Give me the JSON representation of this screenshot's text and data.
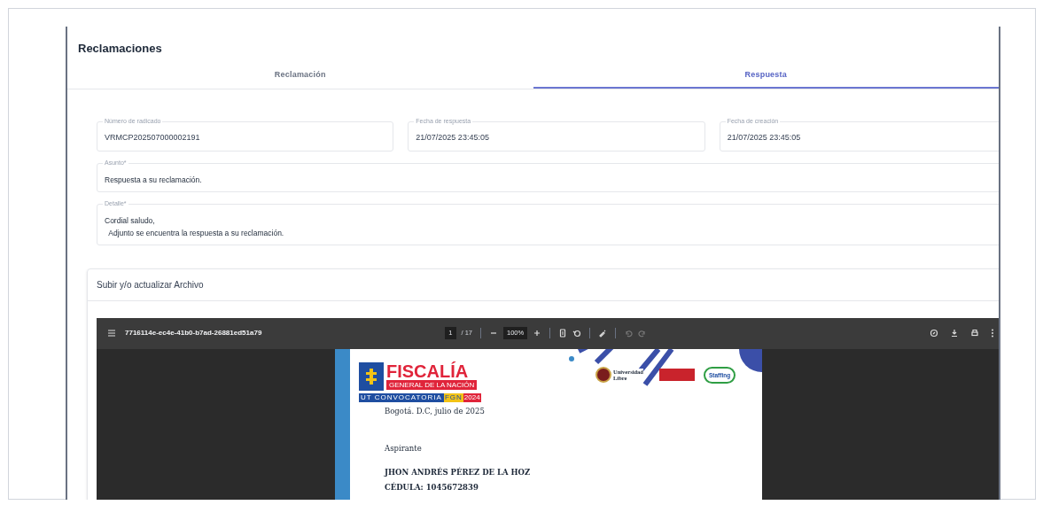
{
  "title": "Reclamaciones",
  "tabs": [
    {
      "label": "Reclamación",
      "selected": false
    },
    {
      "label": "Respuesta",
      "selected": true
    }
  ],
  "field_rows": [
    [
      {
        "label": "Número de radicado",
        "value": "VRMCP202507000002191",
        "kind": "input"
      },
      {
        "label": "Fecha de respuesta",
        "value": "21/07/2025 23:45:05",
        "kind": "input"
      },
      {
        "label": "Fecha de creación",
        "value": "21/07/2025 23:45:05",
        "kind": "input"
      }
    ],
    [
      {
        "label": "Asunto*",
        "lines": [
          "Respuesta a su reclamación."
        ],
        "kind": "textarea"
      }
    ],
    [
      {
        "label": "Detalle*",
        "lines": [
          "Cordial saludo,",
          "  Adjunto se encuentra la respuesta a su reclamación."
        ],
        "kind": "textarea"
      }
    ]
  ],
  "upload": {
    "title": "Subir y/o actualizar Archivo",
    "pdf_viewer": {
      "file_name": "7716114e-ec4e-41b0-b7ad-26881ed51a79",
      "page": "1",
      "page_count": "/ 17",
      "zoom": "100%",
      "document": {
        "logo": {
          "name": "FISCALÍA",
          "subtitle": "GENERAL DE LA NACIÓN",
          "band": "UT CONVOCATORIA",
          "band_code": "FGN",
          "band_year": "2024"
        },
        "partner_logos": [
          {
            "line1": "Universidad",
            "line2": "Libre",
            "kind": "seal"
          },
          {
            "line1": "Staffing",
            "kind": "oval"
          }
        ],
        "lines": [
          {
            "text": "Bogotá. D.C, julio de 2025",
            "bold": false
          },
          {
            "text": "Aspirante",
            "bold": false
          },
          {
            "text": "JHON ANDRÉS PÉREZ DE LA HOZ",
            "bold": true
          },
          {
            "text": "CÉDULA: 1045672839",
            "bold": true
          }
        ]
      }
    }
  }
}
